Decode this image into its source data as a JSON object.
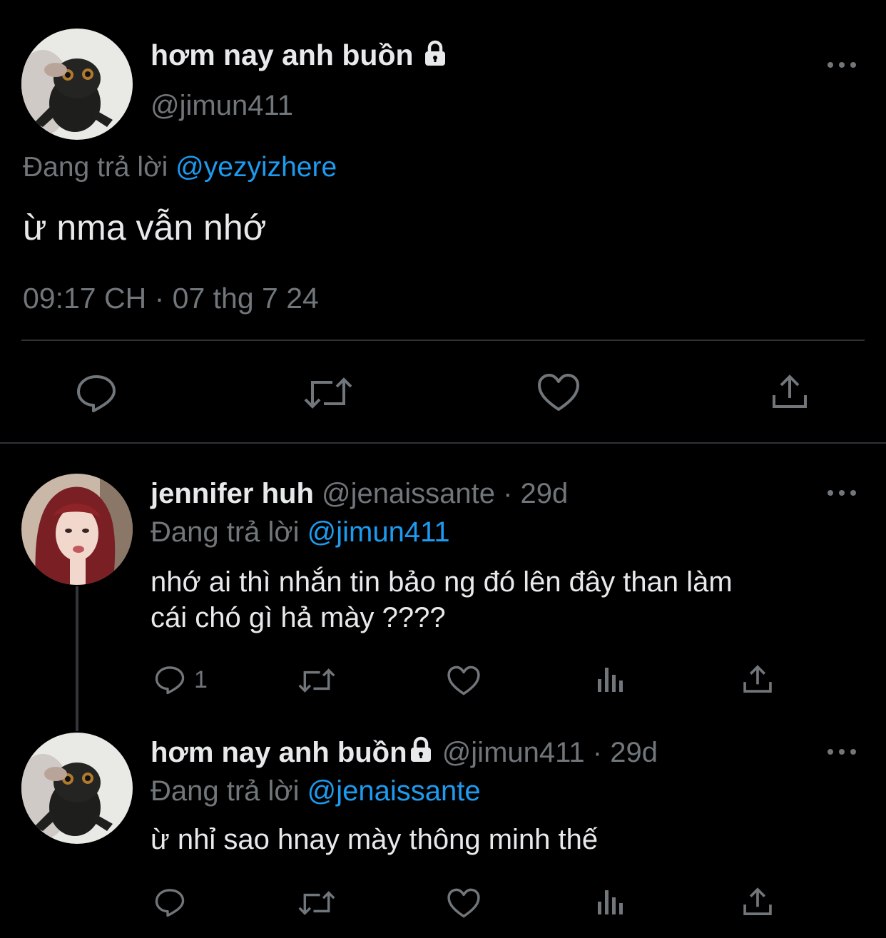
{
  "main_tweet": {
    "display_name": "hơm nay anh buồn",
    "handle": "@jimun411",
    "replying_prefix": "Đang trả lời",
    "replying_to": "@yezyizhere",
    "text": "ừ nma vẫn nhớ",
    "timestamp": "09:17 CH · 07 thg 7 24",
    "icons": {
      "reply": "reply-icon",
      "retweet": "retweet-icon",
      "like": "heart-icon",
      "share": "share-icon",
      "more": "more-icon",
      "lock": "lock-icon"
    }
  },
  "replies": [
    {
      "display_name": "jennifer huh",
      "handle": "@jenaissante",
      "age": "· 29d",
      "replying_prefix": "Đang trả lời",
      "replying_to": "@jimun411",
      "text_line1": "nhớ ai thì nhắn tin bảo ng đó lên đây than làm",
      "text_line2": "cái chó gì hả mày ????",
      "reply_count": "1"
    },
    {
      "display_name": "hơm nay anh buồn",
      "handle": "@jimun411",
      "age": "· 29d",
      "replying_prefix": "Đang trả lời",
      "replying_to": "@jenaissante",
      "text_line1": "ừ nhỉ sao hnay mày thông minh thế",
      "reply_count": ""
    }
  ],
  "colors": {
    "background": "#000000",
    "text": "#e7e9ea",
    "secondary": "#71767b",
    "link": "#1d9bf0",
    "divider": "#2f3336"
  }
}
